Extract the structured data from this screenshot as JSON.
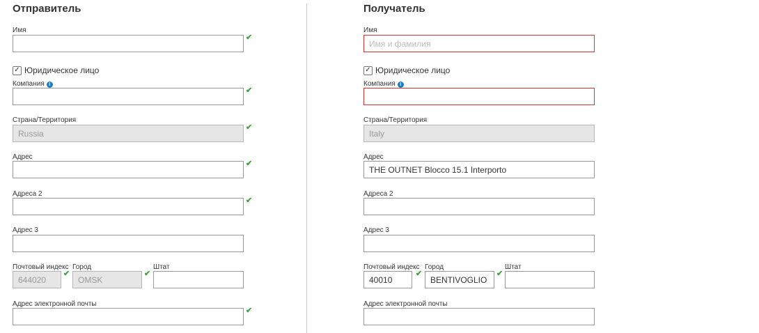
{
  "sender": {
    "title": "Отправитель",
    "name_label": "Имя",
    "name_value": "",
    "legal_entity_label": "Юридическое лицо",
    "company_label": "Компания",
    "company_value": "",
    "country_label": "Страна/Территория",
    "country_value": "Russia",
    "address_label": "Адрес",
    "address_value": "",
    "address2_label": "Адреса 2",
    "address2_value": "",
    "address3_label": "Адрес 3",
    "address3_value": "",
    "postal_label": "Почтовый индекс",
    "postal_value": "644020",
    "city_label": "Город",
    "city_value": "OMSK",
    "state_label": "Штат",
    "state_value": "",
    "email_label": "Адрес электронной почты",
    "email_value": ""
  },
  "recipient": {
    "title": "Получатель",
    "name_label": "Имя",
    "name_placeholder": "Имя и фамилия",
    "legal_entity_label": "Юридическое лицо",
    "company_label": "Компания",
    "company_value": "",
    "country_label": "Страна/Территория",
    "country_value": "Italy",
    "address_label": "Адрес",
    "address_value": "THE OUTNET Blocco 15.1 Interporto",
    "address2_label": "Адреса 2",
    "address2_value": "",
    "address3_label": "Адрес 3",
    "address3_value": "",
    "postal_label": "Почтовый индекс",
    "postal_value": "40010",
    "city_label": "Город",
    "city_value": "BENTIVOGLIO",
    "state_label": "Штат",
    "state_value": "",
    "email_label": "Адрес электронной почты",
    "email_value": ""
  },
  "icons": {
    "valid": "checkmark-icon",
    "info": "info-icon",
    "checkbox": "checkbox-checked-icon"
  },
  "glyphs": {
    "check": "✔",
    "info": "i",
    "checked": "✓"
  },
  "colors": {
    "valid": "#3ca23c",
    "error": "#d9342b",
    "info": "#1f7ac4"
  }
}
